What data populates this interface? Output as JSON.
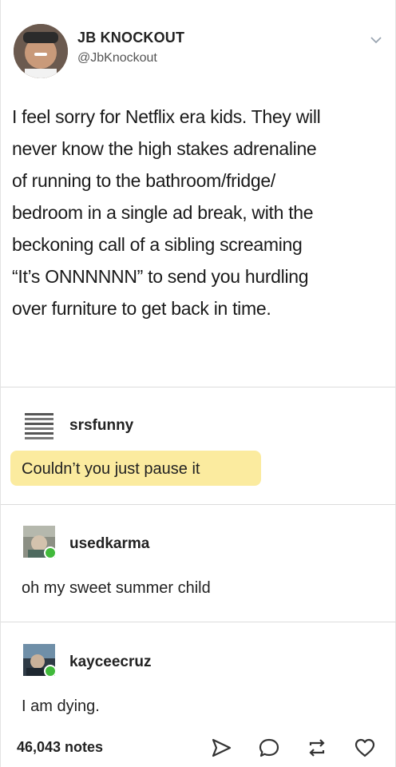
{
  "post": {
    "username": "JB KNOCKOUT",
    "handle": "@JbKnockout",
    "text_lines": [
      "I feel sorry for Netflix era kids. They will",
      "never know the high stakes adrenaline",
      "of running to the bathroom/fridge/",
      "bedroom in a single ad break, with the",
      "beckoning call of a sibling screaming",
      "“It’s ONNNNNN” to send you hurdling",
      "over furniture to get back in time."
    ]
  },
  "reblogs": [
    {
      "username": "srsfunny",
      "text": "Couldn’t you just pause it",
      "highlighted": true
    },
    {
      "username": "usedkarma",
      "text": "oh my sweet summer child"
    },
    {
      "username": "kayceecruz",
      "text": "I am dying."
    }
  ],
  "footer": {
    "notes": "46,043 notes",
    "icons": [
      "share-icon",
      "reply-icon",
      "reblog-icon",
      "like-icon"
    ]
  },
  "colors": {
    "highlight": "#fbeb9f",
    "badge": "#41b93b"
  }
}
